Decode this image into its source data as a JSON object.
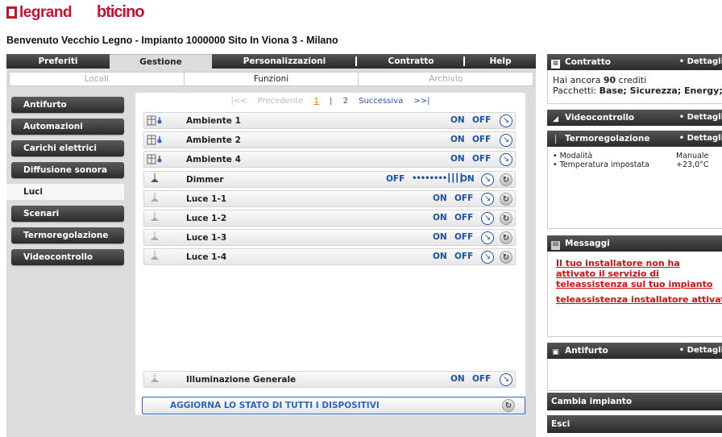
{
  "header": {
    "logo_legrand": "legrand",
    "logo_bticino": "bticino",
    "welcome": "Benvenuto Vecchio Legno - Impianto 1000000 Sito In Viona 3 - Milano"
  },
  "top_tabs": [
    "Preferiti",
    "Gestione",
    "Personalizzazioni",
    "Contratto",
    "Help"
  ],
  "active_top_tab": "Gestione",
  "sub_tabs": [
    "Locali",
    "Funzioni",
    "Archivio"
  ],
  "active_sub_tab": "Funzioni",
  "menu": [
    "Antifurto",
    "Automazioni",
    "Carichi elettrici",
    "Diffusione sonora",
    "Luci",
    "Scenari",
    "Termoregolazione",
    "Videocontrollo"
  ],
  "active_menu": "Luci",
  "pager": {
    "first": "|<<",
    "prev": "Precedente",
    "page1": "1",
    "page2": "2",
    "next": "Successiva",
    "last": ">>|"
  },
  "controls": {
    "on": "ON",
    "off": "OFF",
    "dimmer_level": "••••••••┃┃┃┃"
  },
  "devices": [
    {
      "name": "Ambiente 1",
      "type": "ambiente"
    },
    {
      "name": "Ambiente 2",
      "type": "ambiente"
    },
    {
      "name": "Ambiente 4",
      "type": "ambiente"
    },
    {
      "name": "Dimmer",
      "type": "dimmer"
    },
    {
      "name": "Luce 1-1",
      "type": "luce"
    },
    {
      "name": "Luce 1-2",
      "type": "luce"
    },
    {
      "name": "Luce 1-3",
      "type": "luce"
    },
    {
      "name": "Luce 1-4",
      "type": "luce"
    }
  ],
  "general": {
    "name": "Illuminazione Generale"
  },
  "update_all": "AGGIORNA LO STATO DI TUTTI I DISPOSITIVI",
  "right": {
    "details_link": "• Dettagli",
    "contratto": {
      "title": "Contratto",
      "credits_prefix": "Hai ancora",
      "credits_value": "90",
      "credits_suffix": "crediti",
      "packages_label": "Pacchetti:",
      "packages_value": "Base; Sicurezza; Energy;"
    },
    "videocontrollo": {
      "title": "Videocontrollo"
    },
    "termoregolazione": {
      "title": "Termoregolazione",
      "mode_label": "• Modalità",
      "mode_value": "Manuale",
      "temp_label": "• Temperatura impostata",
      "temp_value": "+23,0°C"
    },
    "messaggi": {
      "title": "Messaggi",
      "msg1": "Il tuo installatore non ha attivato il servizio di teleassistenza sul tuo impianto",
      "msg2": "teleassistenza installatore attivata"
    },
    "antifurto": {
      "title": "Antifurto"
    },
    "cambia": "Cambia impianto",
    "esci": "Esci"
  },
  "colors": {
    "accent": "#1a4fa8",
    "brand": "#c8102e",
    "alert": "#d01010"
  }
}
